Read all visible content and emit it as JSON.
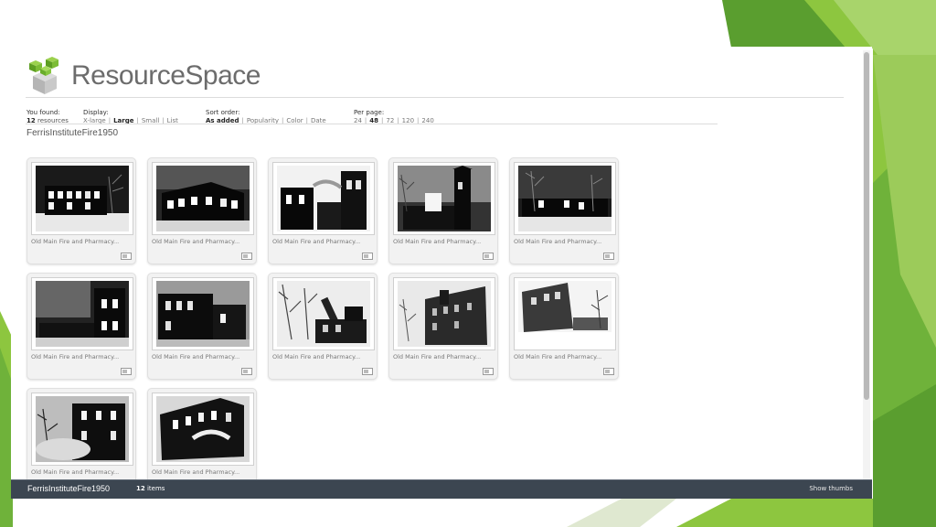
{
  "app": {
    "name": "ResourceSpace"
  },
  "results": {
    "label": "You found:",
    "count": "12",
    "unit": "resources"
  },
  "display": {
    "label": "Display:",
    "options": [
      "X-large",
      "Large",
      "Small",
      "List"
    ],
    "selected": "Large"
  },
  "sort": {
    "label": "Sort order:",
    "options": [
      "As added",
      "Popularity",
      "Color",
      "Date"
    ],
    "selected": "As added"
  },
  "per_page": {
    "label": "Per page:",
    "options": [
      "24",
      "48",
      "72",
      "120",
      "240"
    ],
    "selected": "48"
  },
  "collection": {
    "title": "FerrisInstituteFire1950"
  },
  "resources": [
    {
      "caption": "Old Main Fire and Pharmacy..."
    },
    {
      "caption": "Old Main Fire and Pharmacy..."
    },
    {
      "caption": "Old Main Fire and Pharmacy..."
    },
    {
      "caption": "Old Main Fire and Pharmacy..."
    },
    {
      "caption": "Old Main Fire and Pharmacy..."
    },
    {
      "caption": "Old Main Fire and Pharmacy..."
    },
    {
      "caption": "Old Main Fire and Pharmacy..."
    },
    {
      "caption": "Old Main Fire and Pharmacy..."
    },
    {
      "caption": "Old Main Fire and Pharmacy..."
    },
    {
      "caption": "Old Main Fire and Pharmacy..."
    },
    {
      "caption": "Old Main Fire and Pharmacy..."
    },
    {
      "caption": "Old Main Fire and Pharmacy..."
    }
  ],
  "footer": {
    "collection_title": "FerrisInstituteFire1950",
    "count": "12",
    "count_unit": "items",
    "show_thumbs": "Show thumbs"
  },
  "colors": {
    "accent_green": "#8dc63f",
    "footer_bg": "#3c4651",
    "logo_text": "#6c6c6c"
  },
  "icons": {
    "logo": "green-cubes-logo",
    "preview": "preview-icon"
  }
}
